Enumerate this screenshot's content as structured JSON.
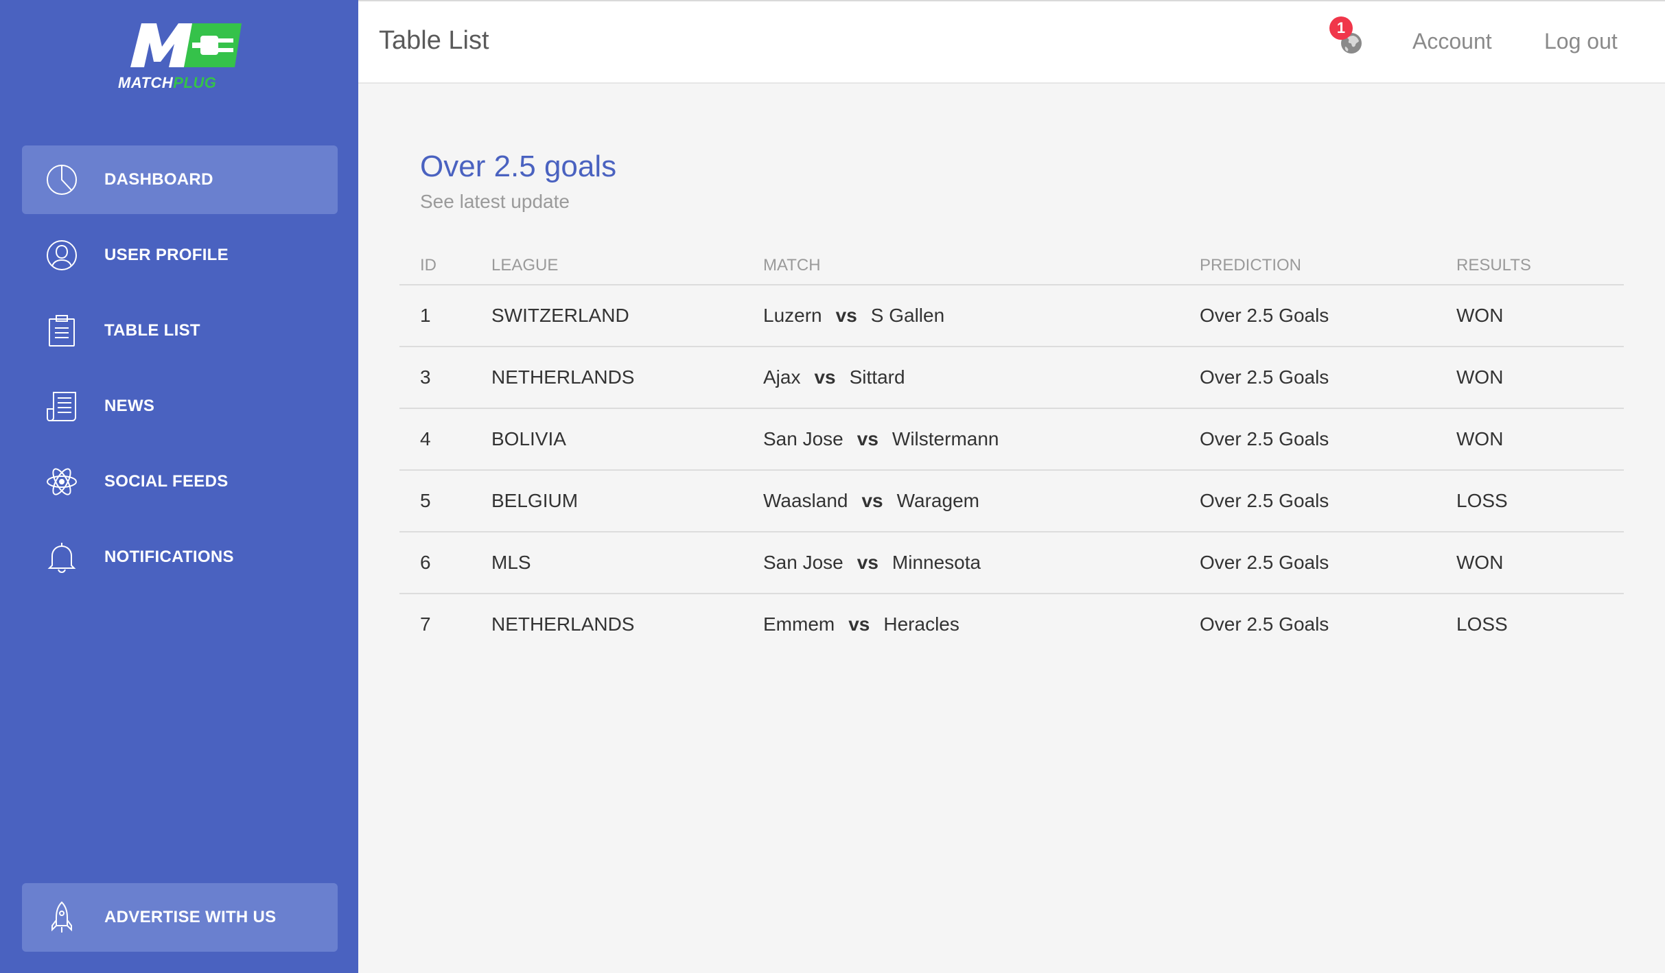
{
  "brand": {
    "logo_text_white": "MATCH",
    "logo_text_green": "PLUG",
    "colors": {
      "sidebar": "#4a62c0",
      "accent_green": "#35c24a",
      "badge": "#f0364a"
    }
  },
  "sidebar": {
    "items": [
      {
        "label": "DASHBOARD",
        "icon": "pie-chart-icon",
        "active": true
      },
      {
        "label": "USER PROFILE",
        "icon": "user-icon"
      },
      {
        "label": "TABLE LIST",
        "icon": "clipboard-icon"
      },
      {
        "label": "NEWS",
        "icon": "newspaper-icon"
      },
      {
        "label": "SOCIAL FEEDS",
        "icon": "atom-icon"
      },
      {
        "label": "NOTIFICATIONS",
        "icon": "bell-icon"
      }
    ],
    "advertise_label": "ADVERTISE WITH US"
  },
  "header": {
    "title": "Table List",
    "notification_count": "1",
    "account_label": "Account",
    "logout_label": "Log out"
  },
  "card": {
    "title": "Over 2.5 goals",
    "subtitle": "See latest update"
  },
  "table": {
    "columns": [
      "ID",
      "LEAGUE",
      "MATCH",
      "PREDICTION",
      "RESULTS"
    ],
    "vs_label": "vs",
    "rows": [
      {
        "id": "1",
        "league": "SWITZERLAND",
        "home": "Luzern",
        "away": "S Gallen",
        "prediction": "Over 2.5 Goals",
        "result": "WON"
      },
      {
        "id": "3",
        "league": "NETHERLANDS",
        "home": "Ajax",
        "away": "Sittard",
        "prediction": "Over 2.5 Goals",
        "result": "WON"
      },
      {
        "id": "4",
        "league": "BOLIVIA",
        "home": "San Jose",
        "away": "Wilstermann",
        "prediction": "Over 2.5 Goals",
        "result": "WON"
      },
      {
        "id": "5",
        "league": "BELGIUM",
        "home": "Waasland",
        "away": "Waragem",
        "prediction": "Over 2.5 Goals",
        "result": "LOSS"
      },
      {
        "id": "6",
        "league": "MLS",
        "home": "San Jose",
        "away": "Minnesota",
        "prediction": "Over 2.5 Goals",
        "result": "WON"
      },
      {
        "id": "7",
        "league": "NETHERLANDS",
        "home": "Emmem",
        "away": "Heracles",
        "prediction": "Over 2.5 Goals",
        "result": "LOSS"
      }
    ]
  }
}
